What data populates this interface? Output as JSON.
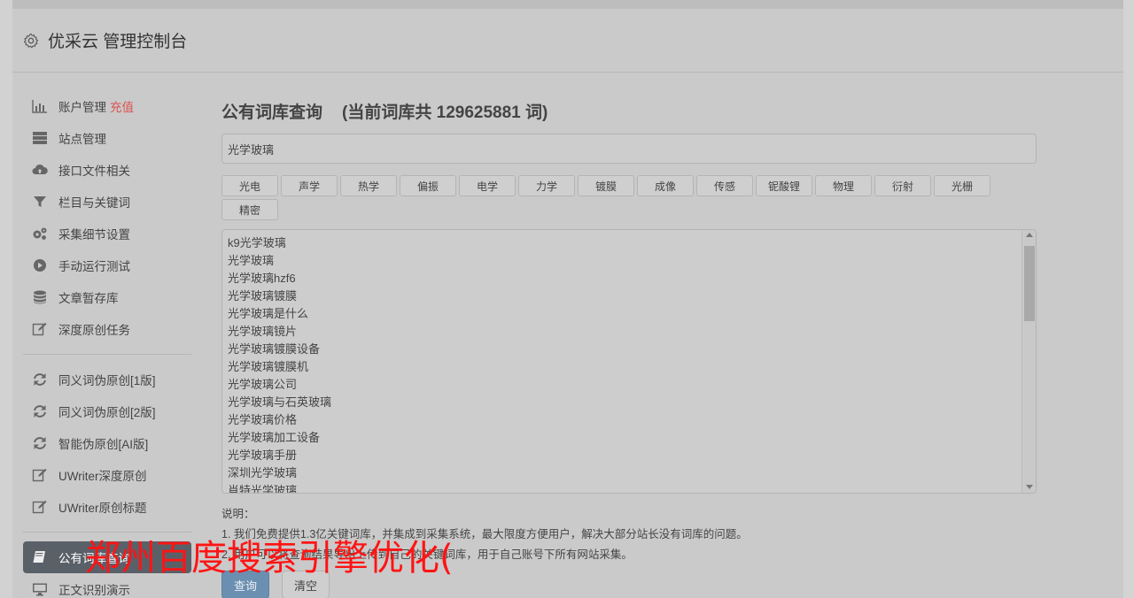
{
  "header": {
    "title": "优采云 管理控制台"
  },
  "sidebar": {
    "group1": [
      {
        "label": "账户管理",
        "badge": "充值",
        "icon": "bar-chart-icon"
      },
      {
        "label": "站点管理",
        "icon": "server-icon"
      },
      {
        "label": "接口文件相关",
        "icon": "cloud-upload-icon"
      },
      {
        "label": "栏目与关键词",
        "icon": "filter-icon"
      },
      {
        "label": "采集细节设置",
        "icon": "cogs-icon"
      },
      {
        "label": "手动运行测试",
        "icon": "play-circle-icon"
      },
      {
        "label": "文章暂存库",
        "icon": "database-icon"
      },
      {
        "label": "深度原创任务",
        "icon": "edit-icon"
      }
    ],
    "group2": [
      {
        "label": "同义词伪原创[1版]",
        "icon": "refresh-icon"
      },
      {
        "label": "同义词伪原创[2版]",
        "icon": "refresh-icon"
      },
      {
        "label": "智能伪原创[AI版]",
        "icon": "refresh-icon"
      },
      {
        "label": "UWriter深度原创",
        "icon": "edit-icon"
      },
      {
        "label": "UWriter原创标题",
        "icon": "edit-icon"
      }
    ],
    "group3": [
      {
        "label": "公有词库查询",
        "icon": "book-icon",
        "active": true
      },
      {
        "label": "正文识别演示",
        "icon": "monitor-icon"
      }
    ]
  },
  "main": {
    "title": "公有词库查询",
    "count_text": "(当前词库共 129625881 词)",
    "search_value": "光学玻璃",
    "tags": [
      "光电",
      "声学",
      "热学",
      "偏振",
      "电学",
      "力学",
      "镀膜",
      "成像",
      "传感",
      "铌酸锂",
      "物理",
      "衍射",
      "光栅",
      "精密"
    ],
    "results": [
      "k9光学玻璃",
      "光学玻璃",
      "光学玻璃hzf6",
      "光学玻璃镀膜",
      "光学玻璃是什么",
      "光学玻璃镜片",
      "光学玻璃镀膜设备",
      "光学玻璃镀膜机",
      "光学玻璃公司",
      "光学玻璃与石英玻璃",
      "光学玻璃价格",
      "光学玻璃加工设备",
      "光学玻璃手册",
      "深圳光学玻璃",
      "肖特光学玻璃"
    ],
    "notes_label": "说明：",
    "note1": "1. 我们免费提供1.3亿关键词库，并集成到采集系统，最大限度方便用户，解决大部分站长没有词库的问题。",
    "note2": "2. 用户可以将查询结果导出上传到自己的关键词库，用于自己账号下所有网站采集。",
    "query_button": "查询",
    "clear_button": "清空"
  },
  "watermark": "郑州百度搜索引擎优化("
}
